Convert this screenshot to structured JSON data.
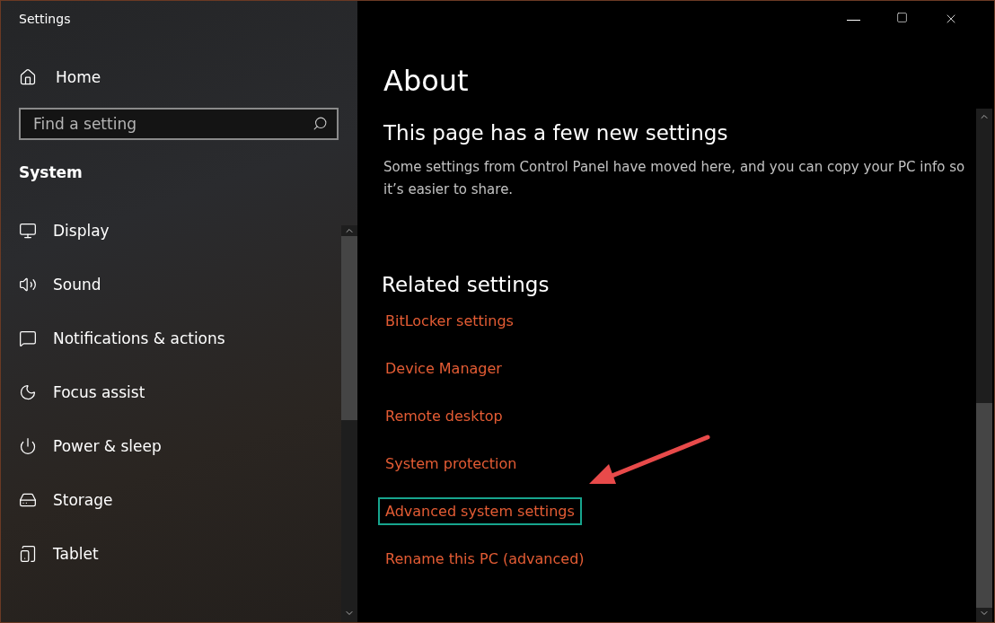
{
  "window": {
    "title": "Settings"
  },
  "sidebar": {
    "home": "Home",
    "search": {
      "placeholder": "Find a setting"
    },
    "section": "System",
    "items": [
      {
        "kind": "display",
        "label": "Display"
      },
      {
        "kind": "sound",
        "label": "Sound"
      },
      {
        "kind": "notifications",
        "label": "Notifications & actions"
      },
      {
        "kind": "focus",
        "label": "Focus assist"
      },
      {
        "kind": "power",
        "label": "Power & sleep"
      },
      {
        "kind": "storage",
        "label": "Storage"
      },
      {
        "kind": "tablet",
        "label": "Tablet"
      }
    ]
  },
  "main": {
    "title": "About",
    "notice": {
      "heading": "This page has a few new settings",
      "text": "Some settings from Control Panel have moved here, and you can copy your PC info so it’s easier to share."
    },
    "related": {
      "heading": "Related settings",
      "links": [
        {
          "label": "BitLocker settings",
          "highlighted": false
        },
        {
          "label": "Device Manager",
          "highlighted": false
        },
        {
          "label": "Remote desktop",
          "highlighted": false
        },
        {
          "label": "System protection",
          "highlighted": false
        },
        {
          "label": "Advanced system settings",
          "highlighted": true
        },
        {
          "label": "Rename this PC (advanced)",
          "highlighted": false
        }
      ]
    }
  }
}
